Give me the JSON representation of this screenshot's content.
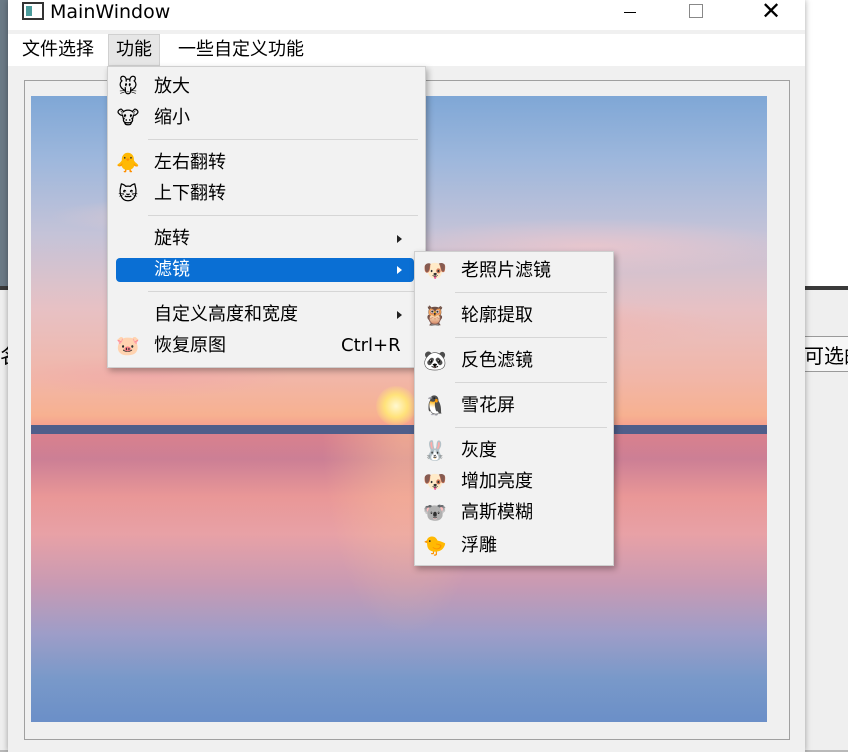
{
  "window": {
    "title": "MainWindow"
  },
  "background": {
    "left_fragment": "名",
    "right_fragment": "可选的"
  },
  "menubar": {
    "items": [
      "文件选择",
      "功能",
      "一些自定义功能"
    ]
  },
  "function_menu": {
    "items": [
      {
        "label": "放大",
        "icon": "mouse-face",
        "glyph": "🐭"
      },
      {
        "label": "缩小",
        "icon": "cow-face",
        "glyph": "🐮"
      },
      {
        "label": "左右翻转",
        "icon": "chick-face",
        "glyph": "🐥"
      },
      {
        "label": "上下翻转",
        "icon": "cat-face",
        "glyph": "🐱"
      },
      {
        "label": "旋转",
        "submenu": true
      },
      {
        "label": "滤镜",
        "submenu": true,
        "highlighted": true
      },
      {
        "label": "自定义高度和宽度",
        "submenu": true
      },
      {
        "label": "恢复原图",
        "icon": "pig-face",
        "glyph": "🐷",
        "shortcut": "Ctrl+R"
      }
    ]
  },
  "filter_submenu": {
    "items": [
      {
        "label": "老照片滤镜",
        "icon": "dog-face",
        "glyph": "🐶"
      },
      {
        "label": "轮廓提取",
        "icon": "owl-face",
        "glyph": "🦉"
      },
      {
        "label": "反色滤镜",
        "icon": "panda-face",
        "glyph": "🐼"
      },
      {
        "label": "雪花屏",
        "icon": "penguin",
        "glyph": "🐧"
      },
      {
        "label": "灰度",
        "icon": "rabbit-face",
        "glyph": "🐰"
      },
      {
        "label": "增加亮度",
        "icon": "pug-face",
        "glyph": "🐶"
      },
      {
        "label": "高斯模糊",
        "icon": "koala-face",
        "glyph": "🐨"
      },
      {
        "label": "浮雕",
        "icon": "chick-face",
        "glyph": "🐤"
      }
    ]
  },
  "colors": {
    "highlight": "#0a6fd4",
    "menu_bg": "#f2f2f2"
  }
}
